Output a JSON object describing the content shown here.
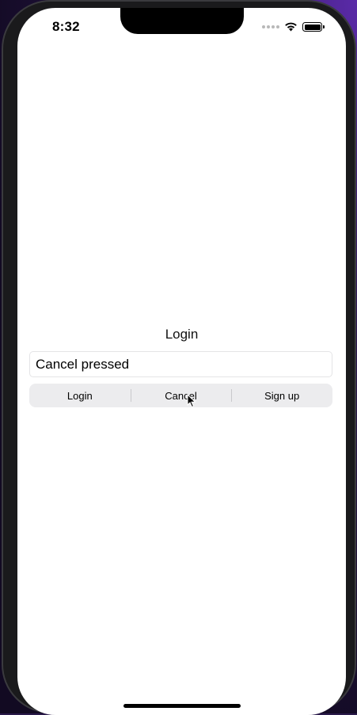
{
  "status_bar": {
    "time": "8:32",
    "icons": [
      "signal-dots-icon",
      "wifi-icon",
      "battery-icon"
    ]
  },
  "login_form": {
    "title": "Login",
    "text_field_value": "Cancel pressed",
    "segments": [
      {
        "label": "Login"
      },
      {
        "label": "Cancel"
      },
      {
        "label": "Sign up"
      }
    ]
  },
  "colors": {
    "screen_background": "#ffffff",
    "segment_background": "#ececee",
    "text": "#000000"
  }
}
